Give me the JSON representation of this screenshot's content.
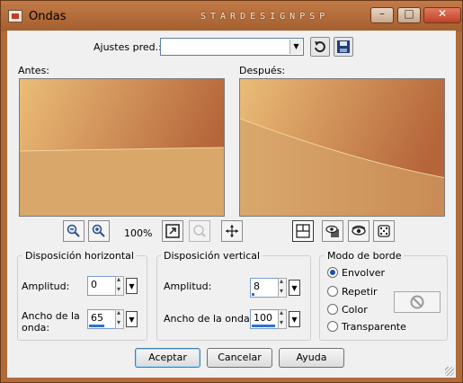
{
  "window": {
    "title": "Ondas",
    "watermark": "STARDESIGNPSP",
    "controls": {
      "minimize": "–",
      "maximize": "□",
      "close": "✕"
    }
  },
  "presets": {
    "label": "Ajustes pred.:",
    "value": ""
  },
  "preview": {
    "before_label": "Antes:",
    "after_label": "Después:",
    "zoom": "100%"
  },
  "horizontal": {
    "title": "Disposición horizontal",
    "amplitude_label": "Amplitud:",
    "amplitude_value": "0",
    "amplitude_level": 0.0,
    "wavelength_label": "Ancho de la onda:",
    "wavelength_value": "65",
    "wavelength_level": 0.65
  },
  "vertical": {
    "title": "Disposición vertical",
    "amplitude_label": "Amplitud:",
    "amplitude_value": "8",
    "amplitude_level": 0.08,
    "wavelength_label": "Ancho de la onda:",
    "wavelength_value": "100",
    "wavelength_level": 1.0
  },
  "edge_mode": {
    "title": "Modo de borde",
    "options": [
      "Envolver",
      "Repetir",
      "Color",
      "Transparente"
    ],
    "selected": "Envolver"
  },
  "buttons": {
    "ok": "Aceptar",
    "cancel": "Cancelar",
    "help": "Ayuda"
  },
  "colors": {
    "titlebar": "#b16b3b",
    "preview_light": "#e9b873",
    "preview_dark": "#b86b3e",
    "preview_lower": "#d6a36a"
  }
}
